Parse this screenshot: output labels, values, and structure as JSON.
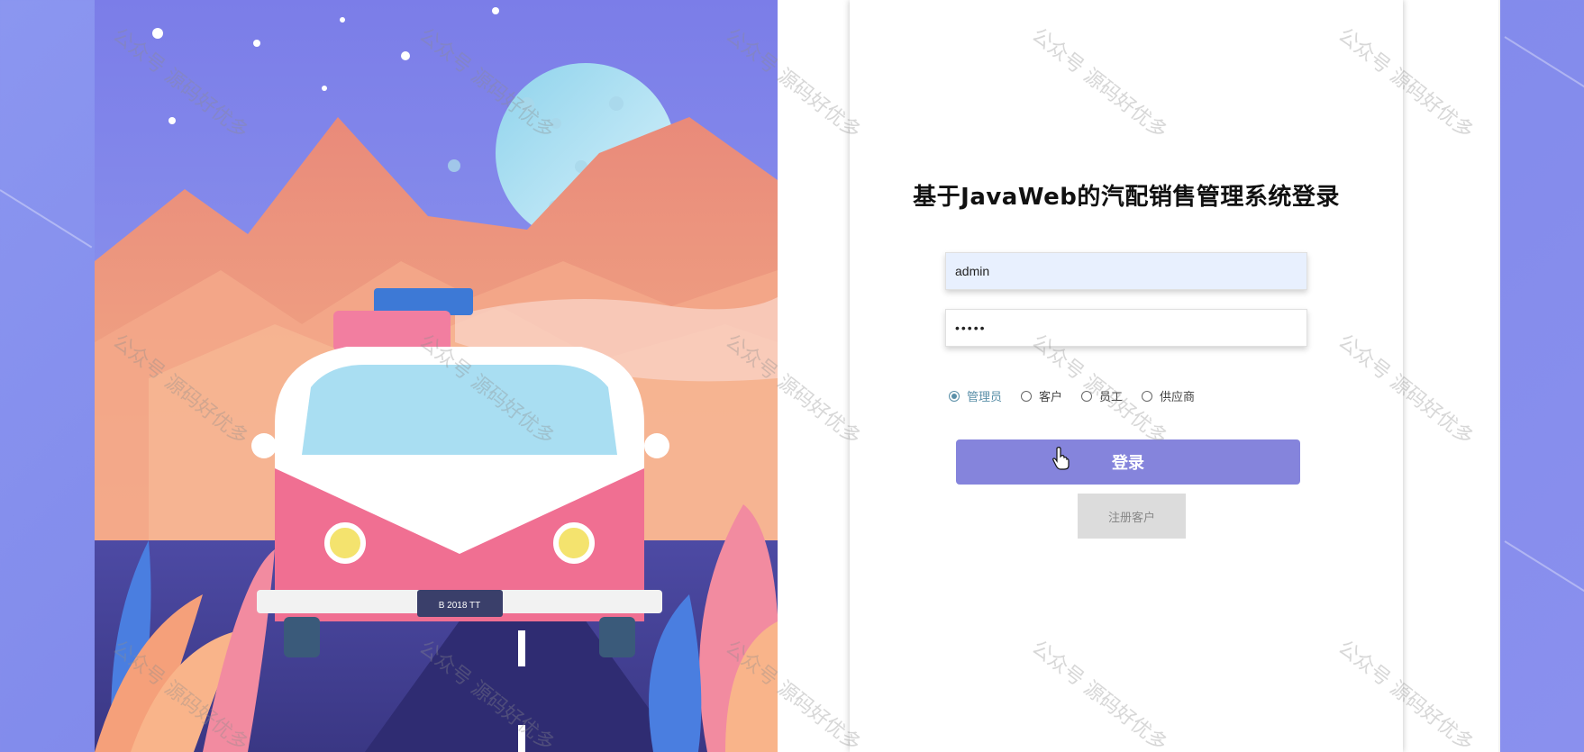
{
  "login": {
    "title": "基于JavaWeb的汽配销售管理系统登录",
    "username_value": "admin",
    "password_value": "•••••",
    "roles": [
      {
        "label": "管理员",
        "checked": true
      },
      {
        "label": "客户",
        "checked": false
      },
      {
        "label": "员工",
        "checked": false
      },
      {
        "label": "供应商",
        "checked": false
      }
    ],
    "login_label": "登录",
    "register_label": "注册客户"
  },
  "illustration": {
    "plate_text": "B 2018 TT"
  },
  "watermark": {
    "text": "公众号 源码好优多"
  },
  "colors": {
    "background": "#8b96f0",
    "login_button": "#8584dc",
    "register_button": "#dcdcdc",
    "radio_accent": "#5a8fa8",
    "username_field_bg": "#e8f0fe"
  }
}
